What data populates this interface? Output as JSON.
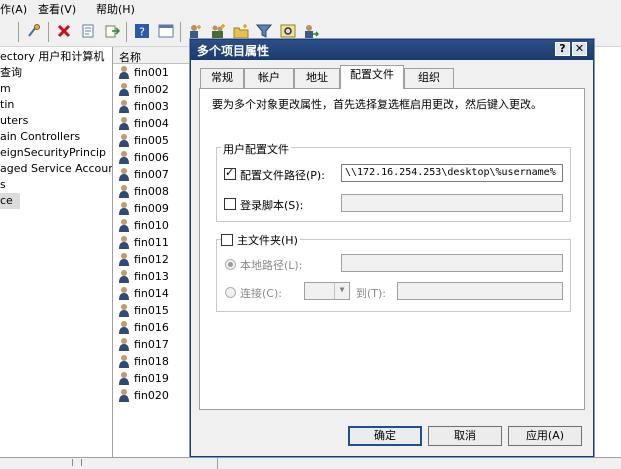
{
  "menubar": {
    "items": [
      "作(A)",
      "查看(V)",
      "帮助(H)"
    ]
  },
  "toolbar": {
    "icons": [
      "key-icon",
      "delete-icon",
      "properties-icon",
      "export-icon",
      "help-icon",
      "console-icon",
      "user-add-icon",
      "group-add-icon",
      "ou-add-icon",
      "filter-icon",
      "find-icon",
      "delegate-icon"
    ]
  },
  "tree": {
    "items": [
      "ectory 用户和计算机",
      "查询",
      "m",
      "tin",
      "uters",
      "ain Controllers",
      "eignSecurityPrincip",
      "aged Service Accour",
      "s",
      "ce"
    ]
  },
  "list": {
    "header": "名称",
    "items": [
      "fin001",
      "fin002",
      "fin003",
      "fin004",
      "fin005",
      "fin006",
      "fin007",
      "fin008",
      "fin009",
      "fin010",
      "fin011",
      "fin012",
      "fin013",
      "fin014",
      "fin015",
      "fin016",
      "fin017",
      "fin018",
      "fin019",
      "fin020"
    ]
  },
  "dialog": {
    "title": "多个项目属性",
    "help_button": "?",
    "close_button": "✕",
    "tabs": [
      "常规",
      "帐户",
      "地址",
      "配置文件",
      "组织"
    ],
    "active_tab": "配置文件",
    "instruction": "要为多个对象更改属性，首先选择复选框启用更改，然后键入更改。",
    "user_profile_group": "用户配置文件",
    "profile_path_label": "配置文件路径(P):",
    "profile_path_value": "\\\\172.16.254.253\\desktop\\%username%",
    "logon_script_label": "登录脚本(S):",
    "logon_script_value": "",
    "home_folder_label": "主文件夹(H)",
    "local_path_label": "本地路径(L):",
    "local_path_value": "",
    "connect_label": "连接(C):",
    "to_label": "到(T):",
    "ok_button": "确定",
    "cancel_button": "取消",
    "apply_button": "应用(A)"
  }
}
